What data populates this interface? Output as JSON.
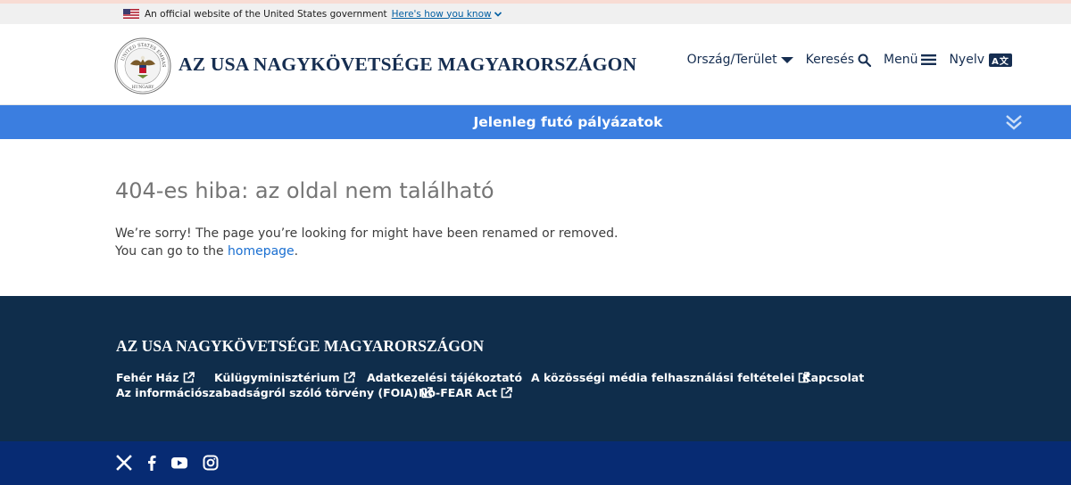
{
  "gov_banner": {
    "text": "An official website of the United States government",
    "link": "Here's how you know"
  },
  "header": {
    "title": "AZ USA NAGYKÖVETSÉGE MAGYARORSZÁGON",
    "nav": {
      "country": "Ország/Terület",
      "search": "Keresés",
      "menu": "Menü",
      "language": "Nyelv",
      "language_badge": "A文"
    }
  },
  "alert_bar": {
    "label": "Jelenleg futó pályázatok"
  },
  "main": {
    "error_title": "404-es hiba: az oldal nem található",
    "message_line1": "We’re sorry! The page you’re looking for might have been renamed or removed.",
    "message_line2_prefix": "You can go to the ",
    "homepage_link": "homepage",
    "message_line2_suffix": "."
  },
  "footer": {
    "title": "AZ USA NAGYKÖVETSÉGE MAGYARORSZÁGON",
    "links": [
      {
        "label": "Fehér Ház",
        "external": true
      },
      {
        "label": "Külügyminisztérium",
        "external": true
      },
      {
        "label": "Adatkezelési tájékoztató",
        "external": false
      },
      {
        "label": "A közösségi média felhasználási feltételei",
        "external": true
      },
      {
        "label": "Kapcsolat",
        "external": false
      },
      {
        "label": "Az információszabadságról szóló törvény (FOIA)",
        "external": true
      },
      {
        "label": "No-FEAR Act",
        "external": true
      }
    ],
    "social": [
      "x-icon",
      "facebook-icon",
      "youtube-icon",
      "instagram-icon"
    ]
  },
  "colors": {
    "navy": "#162e51",
    "alert_blue": "#3b7ee0",
    "footer_bg": "#0f2d4b",
    "social_bg": "#072b73",
    "link_blue": "#1a6fd1"
  }
}
